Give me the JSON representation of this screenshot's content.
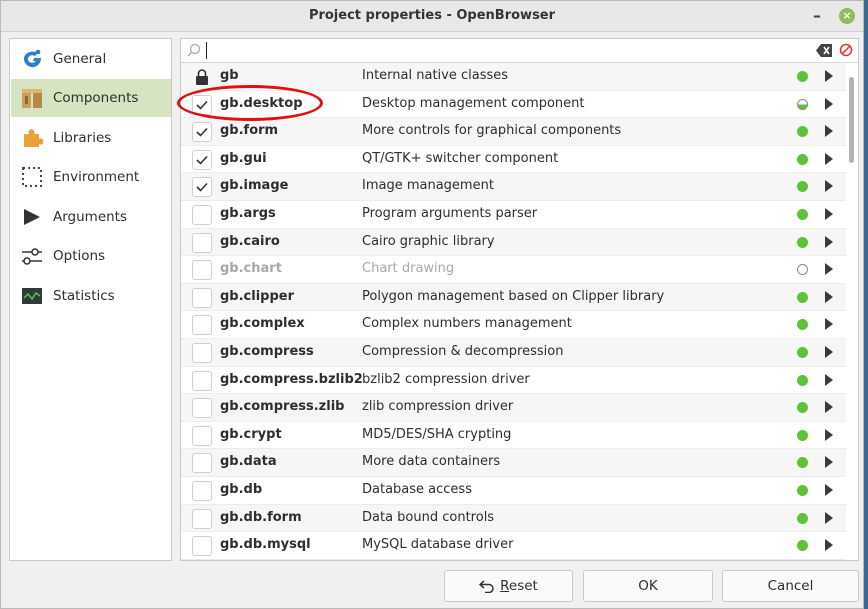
{
  "window": {
    "title": "Project properties - OpenBrowser",
    "minimize_glyph": "–",
    "close_glyph": "×"
  },
  "sidebar": {
    "items": [
      {
        "label": "General",
        "icon": "gambas-logo-icon"
      },
      {
        "label": "Components",
        "icon": "components-box-icon",
        "selected": true
      },
      {
        "label": "Libraries",
        "icon": "puzzle-piece-icon"
      },
      {
        "label": "Environment",
        "icon": "dotted-frame-icon"
      },
      {
        "label": "Arguments",
        "icon": "play-arrow-icon"
      },
      {
        "label": "Options",
        "icon": "slider-options-icon"
      },
      {
        "label": "Statistics",
        "icon": "chart-line-icon"
      }
    ]
  },
  "search": {
    "value": ""
  },
  "components": [
    {
      "name": "gb",
      "description": "Internal native classes",
      "state": "locked",
      "status": "on"
    },
    {
      "name": "gb.desktop",
      "description": "Desktop management component",
      "state": "checked",
      "status": "half"
    },
    {
      "name": "gb.form",
      "description": "More controls for graphical components",
      "state": "checked",
      "status": "on"
    },
    {
      "name": "gb.gui",
      "description": "QT/GTK+ switcher component",
      "state": "checked",
      "status": "on"
    },
    {
      "name": "gb.image",
      "description": "Image management",
      "state": "checked",
      "status": "on"
    },
    {
      "name": "gb.args",
      "description": "Program arguments parser",
      "state": "unchecked",
      "status": "on"
    },
    {
      "name": "gb.cairo",
      "description": "Cairo graphic library",
      "state": "unchecked",
      "status": "on"
    },
    {
      "name": "gb.chart",
      "description": "Chart drawing",
      "state": "disabled",
      "status": "off"
    },
    {
      "name": "gb.clipper",
      "description": "Polygon management based on Clipper library",
      "state": "unchecked",
      "status": "on"
    },
    {
      "name": "gb.complex",
      "description": "Complex numbers management",
      "state": "unchecked",
      "status": "on"
    },
    {
      "name": "gb.compress",
      "description": "Compression & decompression",
      "state": "unchecked",
      "status": "on"
    },
    {
      "name": "gb.compress.bzlib2",
      "description": "bzlib2 compression driver",
      "state": "unchecked",
      "status": "on"
    },
    {
      "name": "gb.compress.zlib",
      "description": "zlib compression driver",
      "state": "unchecked",
      "status": "on"
    },
    {
      "name": "gb.crypt",
      "description": "MD5/DES/SHA crypting",
      "state": "unchecked",
      "status": "on"
    },
    {
      "name": "gb.data",
      "description": "More data containers",
      "state": "unchecked",
      "status": "on"
    },
    {
      "name": "gb.db",
      "description": "Database access",
      "state": "unchecked",
      "status": "on"
    },
    {
      "name": "gb.db.form",
      "description": "Data bound controls",
      "state": "unchecked",
      "status": "on"
    },
    {
      "name": "gb.db.mysql",
      "description": "MySQL database driver",
      "state": "unchecked",
      "status": "on"
    }
  ],
  "buttons": {
    "reset": "Reset",
    "ok": "OK",
    "cancel": "Cancel"
  },
  "colors": {
    "selected_sidebar": "#d6e4c2",
    "status_green": "#5ec13a",
    "annotation_red": "#e01010"
  }
}
